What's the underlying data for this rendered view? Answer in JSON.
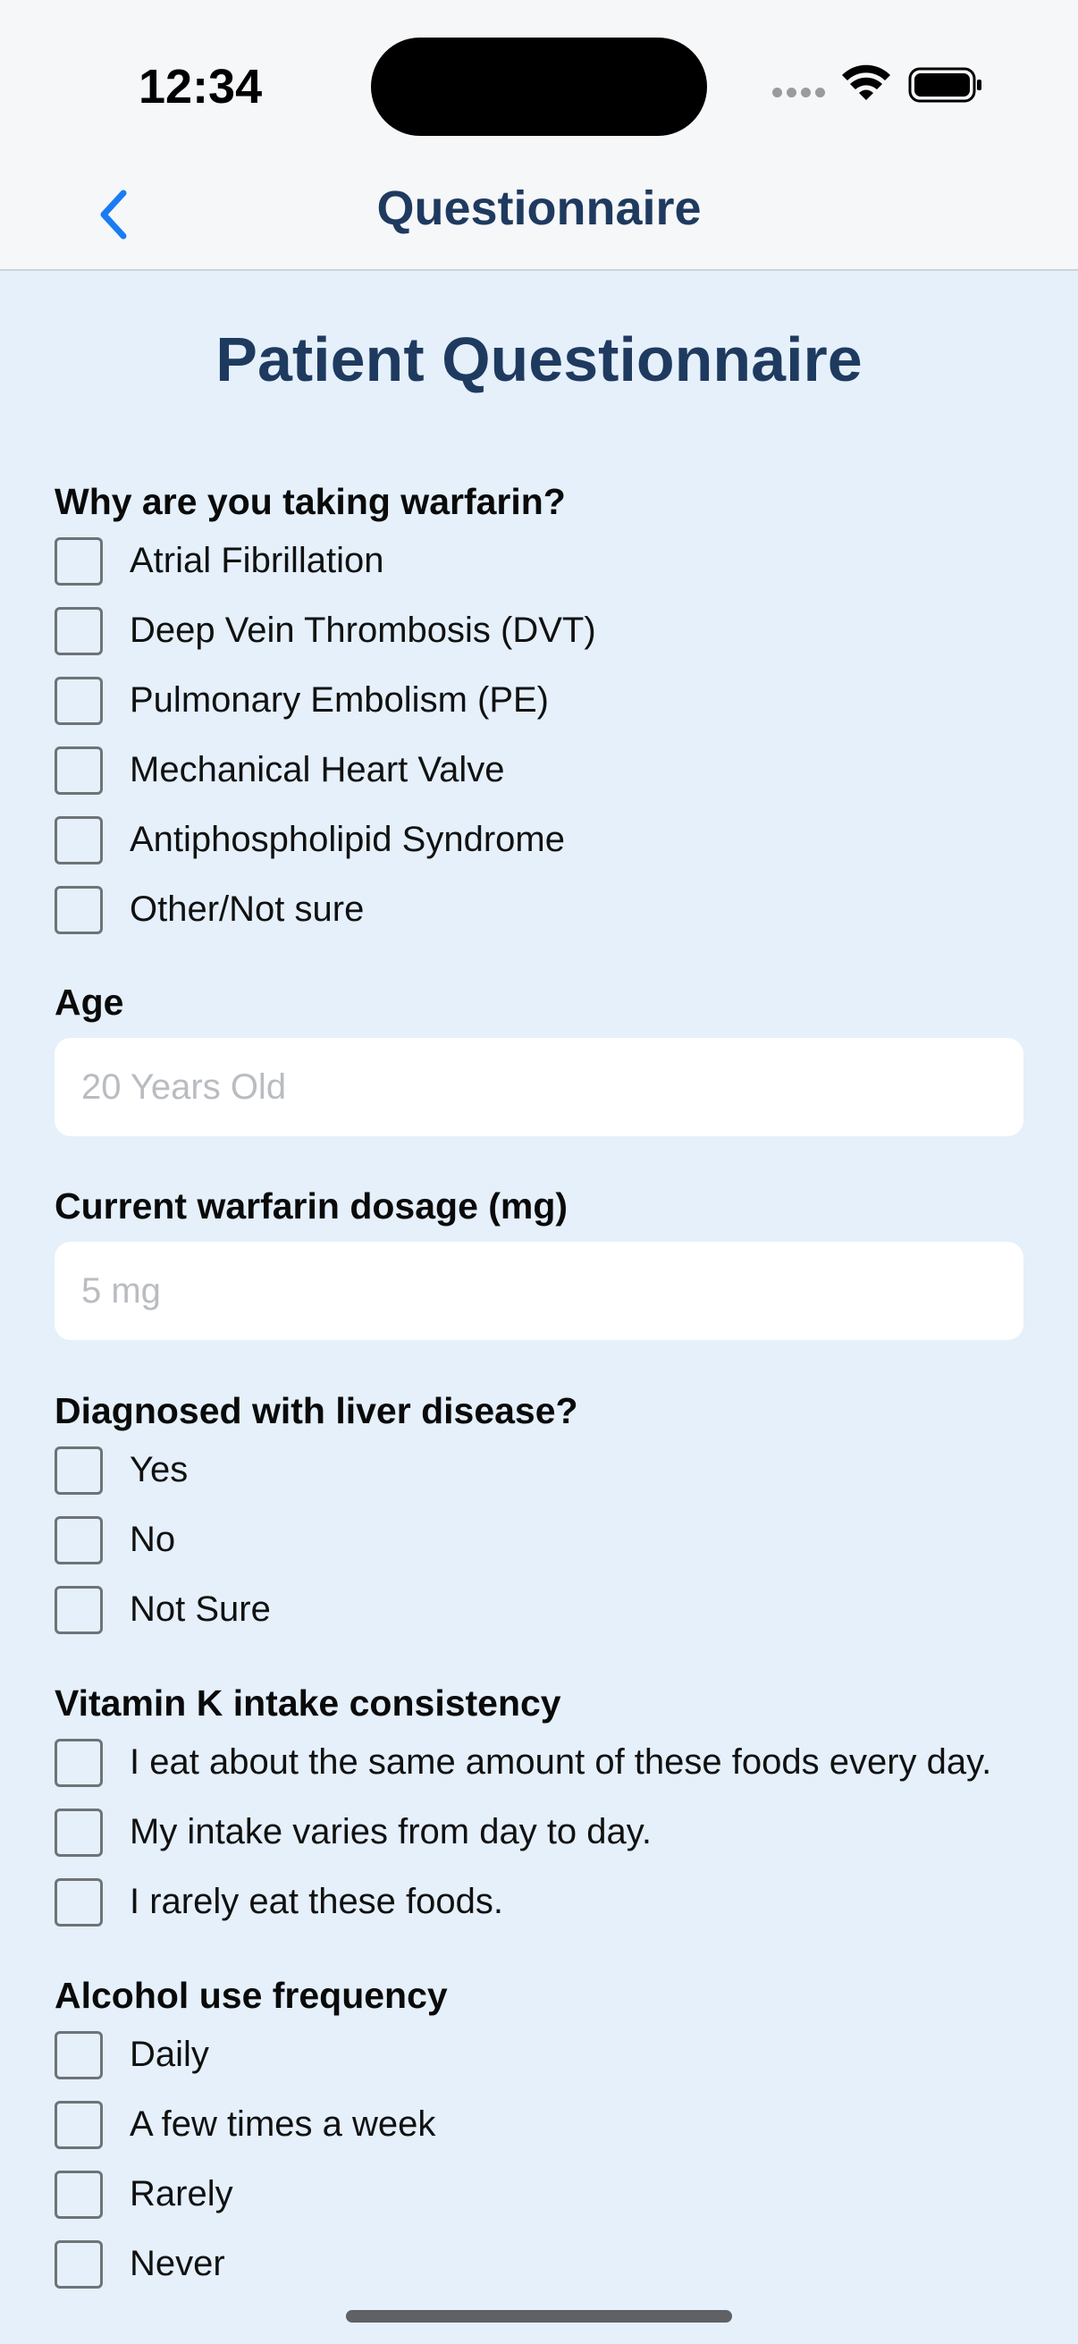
{
  "status_bar": {
    "time": "12:34"
  },
  "nav": {
    "title": "Questionnaire"
  },
  "page": {
    "title": "Patient Questionnaire"
  },
  "questions": {
    "reason": {
      "label": "Why are you taking warfarin?",
      "options": [
        "Atrial Fibrillation",
        "Deep Vein Thrombosis (DVT)",
        "Pulmonary Embolism (PE)",
        "Mechanical Heart Valve",
        "Antiphospholipid Syndrome",
        "Other/Not sure"
      ]
    },
    "age": {
      "label": "Age",
      "placeholder": "20 Years Old",
      "value": ""
    },
    "dosage": {
      "label": "Current warfarin dosage (mg)",
      "placeholder": "5 mg",
      "value": ""
    },
    "liver": {
      "label": "Diagnosed with liver disease?",
      "options": [
        "Yes",
        "No",
        "Not Sure"
      ]
    },
    "vitamin_k": {
      "label": "Vitamin K intake consistency",
      "options": [
        "I eat about the same amount of these foods every day.",
        "My intake varies from day to day.",
        "I rarely eat these foods."
      ]
    },
    "alcohol": {
      "label": "Alcohol use frequency",
      "options": [
        "Daily",
        "A few times a week",
        "Rarely",
        "Never"
      ]
    }
  },
  "colors": {
    "accent": "#1a7cf3",
    "title": "#1f3a5f",
    "background": "#e5f0fb"
  }
}
